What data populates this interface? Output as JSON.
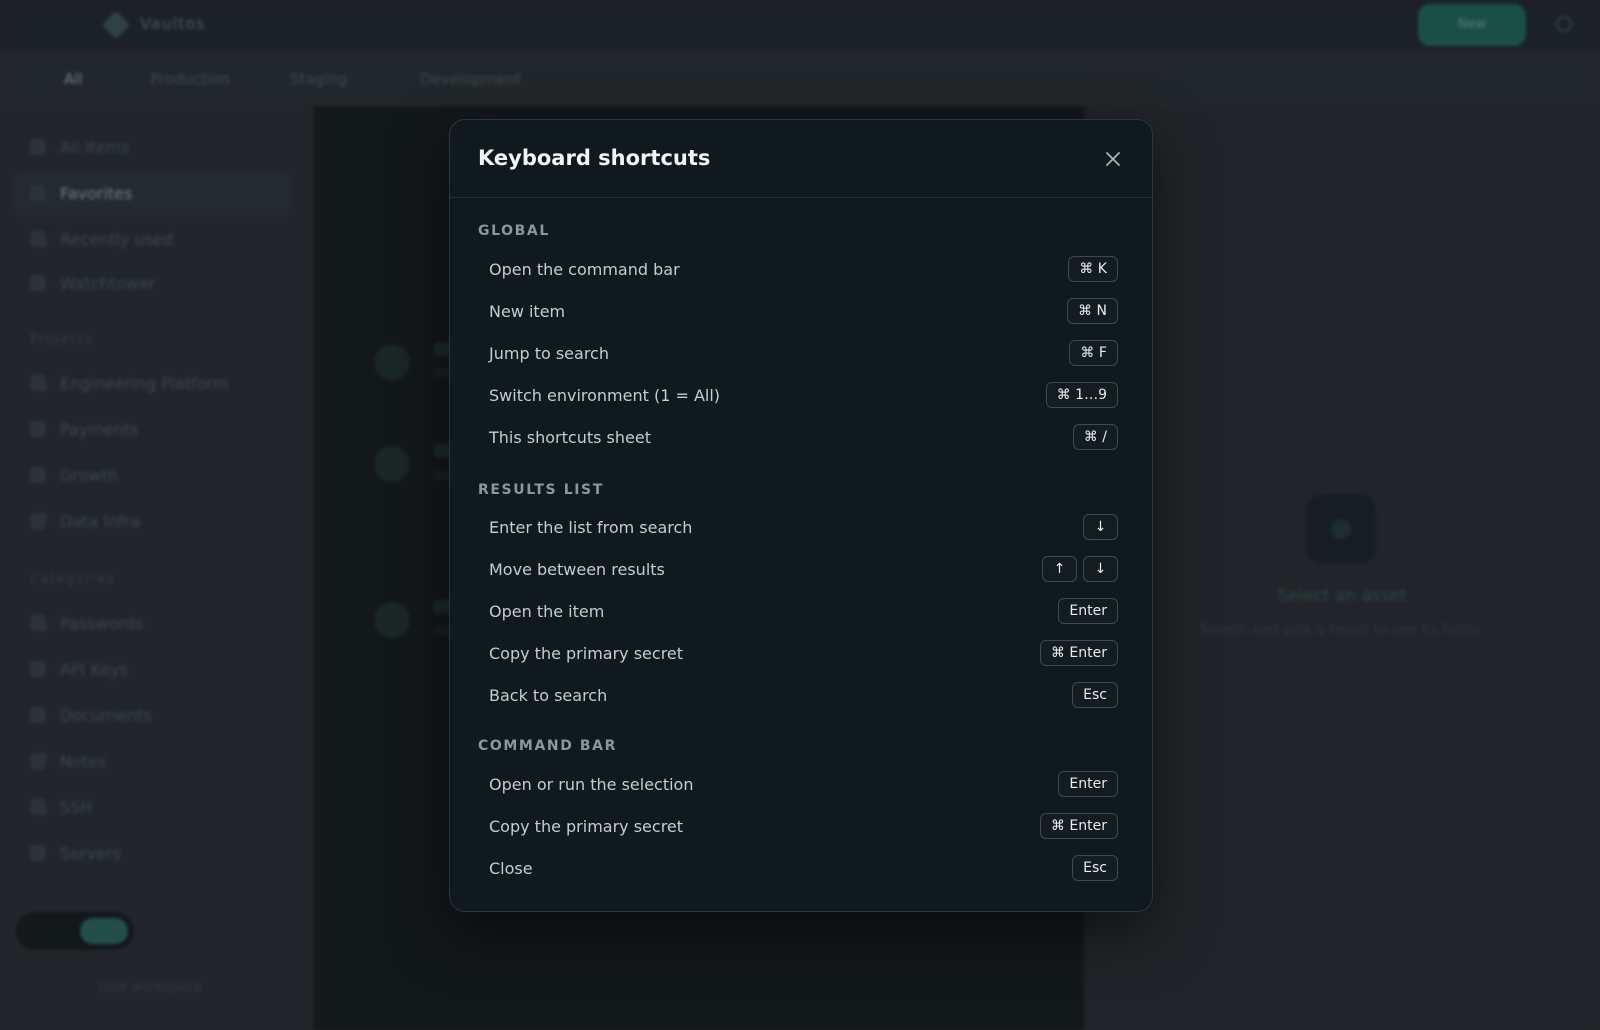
{
  "background": {
    "app_name": "Vaultos",
    "new_button_label": "New",
    "env_tabs": [
      "All",
      "Production",
      "Staging",
      "Development"
    ],
    "sidebar": {
      "items": [
        "All items",
        "Favorites",
        "Recently used",
        "Watchtower"
      ],
      "section_1_title": "Projects",
      "section_1_items": [
        "Engineering Platform",
        "Payments",
        "Growth",
        "Data Infra"
      ],
      "section_2_title": "Categories",
      "section_2_items": [
        "Passwords",
        "API Keys",
        "Documents",
        "Notes",
        "SSH",
        "Servers"
      ],
      "footer": "Lock workspace"
    },
    "detail": {
      "title": "Select an asset",
      "subtitle": "Search and pick a result to see its fields."
    }
  },
  "modal": {
    "title": "Keyboard shortcuts",
    "close_icon": "close-icon",
    "sections": [
      {
        "title": "GLOBAL",
        "rows": [
          {
            "label": "Open the command bar",
            "keys": [
              "⌘ K"
            ]
          },
          {
            "label": "New item",
            "keys": [
              "⌘ N"
            ]
          },
          {
            "label": "Jump to search",
            "keys": [
              "⌘ F"
            ]
          },
          {
            "label": "Switch environment (1 = All)",
            "keys": [
              "⌘ 1…9"
            ]
          },
          {
            "label": "This shortcuts sheet",
            "keys": [
              "⌘ /"
            ]
          }
        ]
      },
      {
        "title": "RESULTS LIST",
        "rows": [
          {
            "label": "Enter the list from search",
            "keys": [
              "↓"
            ]
          },
          {
            "label": "Move between results",
            "keys": [
              "↑",
              "↓"
            ]
          },
          {
            "label": "Open the item",
            "keys": [
              "Enter"
            ]
          },
          {
            "label": "Copy the primary secret",
            "keys": [
              "⌘ Enter"
            ]
          },
          {
            "label": "Back to search",
            "keys": [
              "Esc"
            ]
          }
        ]
      },
      {
        "title": "COMMAND BAR",
        "rows": [
          {
            "label": "Open or run the selection",
            "keys": [
              "Enter"
            ]
          },
          {
            "label": "Copy the primary secret",
            "keys": [
              "⌘ Enter"
            ]
          },
          {
            "label": "Close",
            "keys": [
              "Esc"
            ]
          }
        ]
      }
    ]
  }
}
